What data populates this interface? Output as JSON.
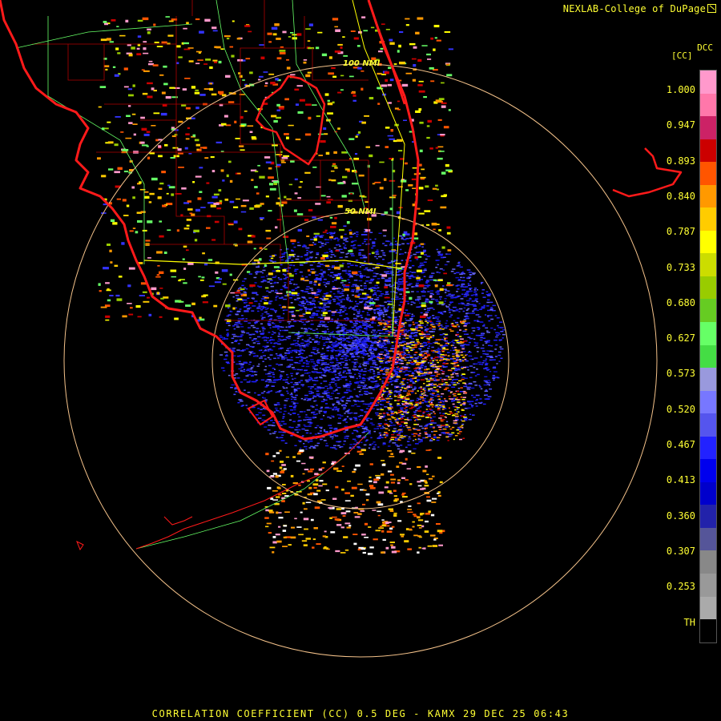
{
  "credit": "NEXLAB-College of DuPage",
  "footer": "CORRELATION COEFFICIENT (CC) 0.5 DEG - KAMX 29 DEC 25 06:43",
  "legend": {
    "title": "DCC",
    "unit": "[CC]",
    "ticks": [
      "1.000",
      "0.947",
      "0.893",
      "0.840",
      "0.787",
      "0.733",
      "0.680",
      "0.627",
      "0.573",
      "0.520",
      "0.467",
      "0.413",
      "0.360",
      "0.307",
      "0.253",
      "TH"
    ]
  },
  "range_rings": [
    "100 NMI",
    "50 NMI"
  ],
  "colors": {
    "text": "#ffff33",
    "coastline": "#ff1a1a",
    "ring": "#f4c28a",
    "county": "#b00000",
    "highway": "#ffff00",
    "minor_road": "#66ff66",
    "blue": "#1c1cff",
    "colorbar_stops": [
      "#ff99cc",
      "#ff77aa",
      "#cc2266",
      "#cc0000",
      "#ff5500",
      "#ff9900",
      "#ffcc00",
      "#ffff00",
      "#ccdd00",
      "#99cc00",
      "#66cc22",
      "#66ff66",
      "#44dd44",
      "#9999dd",
      "#7777ff",
      "#5555ee",
      "#2222ff",
      "#0000ee",
      "#0000cc",
      "#2222aa",
      "#555599",
      "#888888",
      "#999999",
      "#aaaaaa",
      "#000000"
    ]
  }
}
